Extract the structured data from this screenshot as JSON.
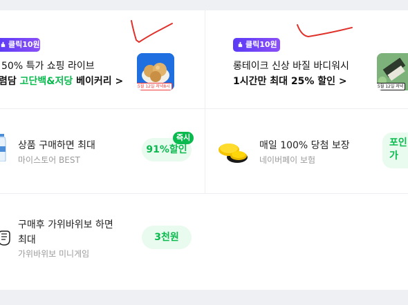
{
  "colors": {
    "accent_green": "#0bba4f",
    "chip_purple": "#6a45f6",
    "pen_red": "#e0312b"
  },
  "promos": [
    {
      "chip_label": "클릭10원",
      "line1": "50% 특가 쇼핑 라이브",
      "line2_prefix": "렴담 ",
      "line2_highlight": "고단백&저당",
      "line2_suffix": " 베이커리 >",
      "thumb_caption": "5월 12일 저녁8시"
    },
    {
      "chip_label": "클릭10원",
      "line1": "롱테이크 신상 바질 바디워시",
      "line2": "1시간만 최대 25% 할인 >",
      "thumb_caption": "5월 12일 저녁"
    }
  ],
  "rewards": [
    {
      "title": "상품 구매하면 최대",
      "subtitle": "마이스토어 BEST",
      "badge": "91%할인",
      "tag": "즉시",
      "icon": "water-bottle-icon"
    },
    {
      "title": "매일 100% 당첨 보장",
      "subtitle": "네이버페이 보험",
      "badge": "포인\n가",
      "icon": "gold-coins-icon"
    },
    {
      "title": "구매후 가위바위보 하면\n최대",
      "subtitle": "가위바위보 미니게임",
      "badge": "3천원",
      "icon": "hand-rock-icon"
    }
  ]
}
